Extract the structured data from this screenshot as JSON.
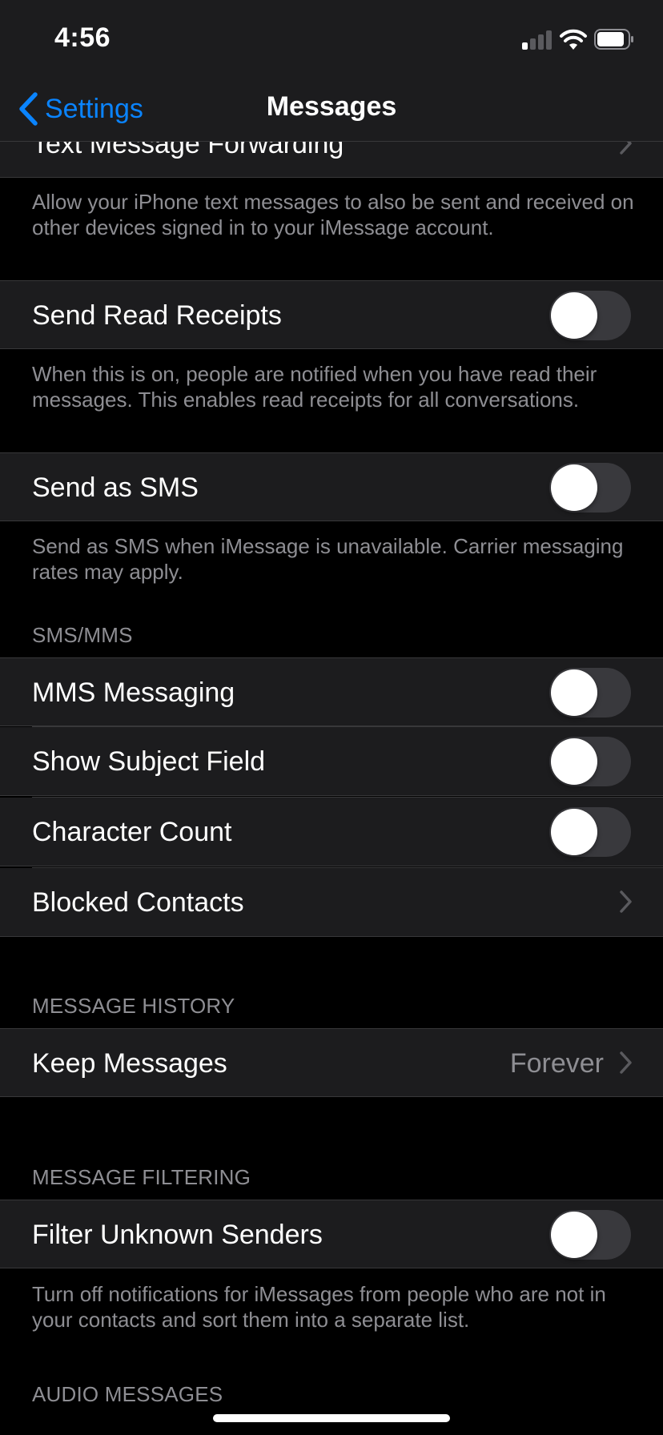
{
  "status_bar": {
    "time": "4:56"
  },
  "nav": {
    "back_label": "Settings",
    "title": "Messages"
  },
  "rows": {
    "text_forwarding": {
      "label": "Text Message Forwarding"
    },
    "read_receipts": {
      "label": "Send Read Receipts",
      "on": false
    },
    "send_sms": {
      "label": "Send as SMS",
      "on": false
    },
    "mms": {
      "label": "MMS Messaging",
      "on": false
    },
    "subject_field": {
      "label": "Show Subject Field",
      "on": false
    },
    "char_count": {
      "label": "Character Count",
      "on": false
    },
    "blocked": {
      "label": "Blocked Contacts"
    },
    "keep_messages": {
      "label": "Keep Messages",
      "value": "Forever"
    },
    "filter_unknown": {
      "label": "Filter Unknown Senders",
      "on": false
    }
  },
  "footnotes": {
    "forwarding": "Allow your iPhone text messages to also be sent and received on other devices signed in to your iMessage account.",
    "read_receipts": "When this is on, people are notified when you have read their messages. This enables read receipts for all conversations.",
    "send_sms": "Send as SMS when iMessage is unavailable. Carrier messaging rates may apply.",
    "filter_unknown": "Turn off notifications for iMessages from people who are not in your contacts and sort them into a separate list."
  },
  "section_headers": {
    "sms_mms": "SMS/MMS",
    "message_history": "MESSAGE HISTORY",
    "message_filtering": "MESSAGE FILTERING",
    "audio_messages": "AUDIO MESSAGES"
  },
  "colors": {
    "accent": "#0a84ff",
    "cell_bg": "#1c1c1e",
    "toggle_off": "#39393d",
    "secondary_text": "#8e8e93"
  }
}
